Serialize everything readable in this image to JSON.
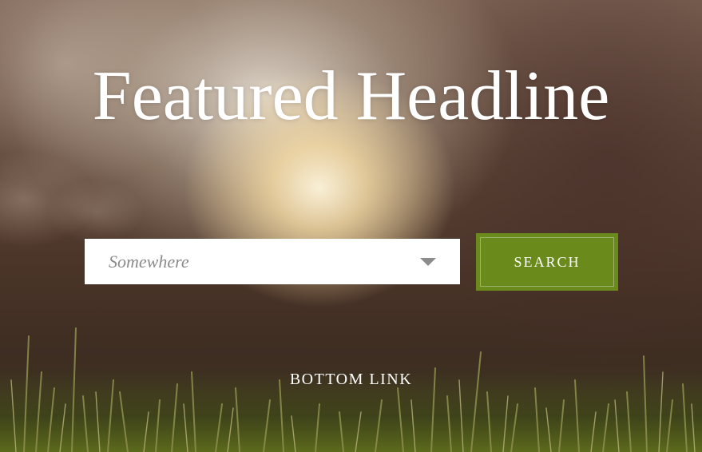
{
  "hero": {
    "headline": "Featured Headline"
  },
  "search_form": {
    "location_select": {
      "selected": "Somewhere",
      "arrow_icon": "chevron-down-icon"
    },
    "search_label": "SEARCH",
    "button_color": "#6a8a1c"
  },
  "footer": {
    "bottom_link_label": "BOTTOM LINK"
  }
}
